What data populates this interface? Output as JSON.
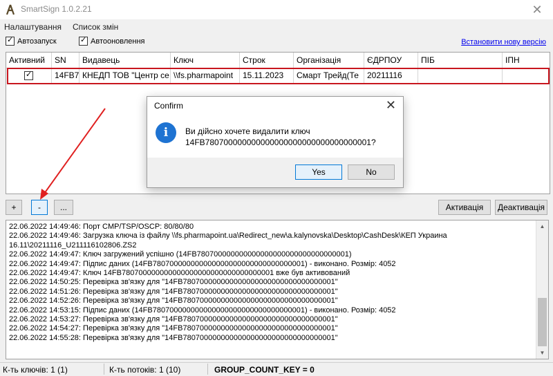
{
  "window": {
    "title": "SmartSign 1.0.2.21",
    "close_glyph": "✕"
  },
  "menu": {
    "items": [
      "Налаштування",
      "Список змін"
    ]
  },
  "options": {
    "autostart": {
      "label": "Автозапуск",
      "checked": true
    },
    "autoupdate": {
      "label": "Автооновлення",
      "checked": true
    },
    "new_version_link": "Встановити нову версію"
  },
  "table": {
    "headers": [
      "Активний",
      "SN",
      "Видавець",
      "Ключ",
      "Строк",
      "Організація",
      "ЄДРПОУ",
      "ПІБ",
      "ІПН"
    ],
    "rows": [
      {
        "active": true,
        "sn": "14FB7",
        "issuer": "КНЕДП ТОВ \"Центр се",
        "key": "\\\\fs.pharmapoint",
        "term": "15.11.2023",
        "organization": "Смарт Трейд(Те",
        "edrpou": "20211116",
        "pib": "",
        "ipn": ""
      }
    ]
  },
  "buttons": {
    "add": "+",
    "remove": "-",
    "more": "...",
    "activate": "Активація",
    "deactivate": "Деактивація"
  },
  "log": [
    "22.06.2022 14:49:46:   Порт CMP/TSP/OSCP: 80/80/80",
    "22.06.2022 14:49:46: Загрузка ключа із файлу \\\\fs.pharmapoint.ua\\Redirect_new\\a.kalynovska\\Desktop\\CashDesk\\КЕП Украина",
    "16.11\\20211116_U211116102806.ZS2",
    "22.06.2022 14:49:47: Ключ загружений успішно (14FB780700000000000000000000000000000001)",
    "22.06.2022 14:49:47: Підпис даних (14FB780700000000000000000000000000000001) - виконано. Розмір: 4052",
    "22.06.2022 14:49:47: Ключ 14FB780700000000000000000000000000000001 вже був активований",
    "22.06.2022 14:50:25: Перевірка зв'язку для \"14FB780700000000000000000000000000000001\"",
    "22.06.2022 14:51:26: Перевірка зв'язку для \"14FB780700000000000000000000000000000001\"",
    "22.06.2022 14:52:26: Перевірка зв'язку для \"14FB780700000000000000000000000000000001\"",
    "22.06.2022 14:53:15: Підпис даних (14FB780700000000000000000000000000000001) - виконано. Розмір: 4052",
    "22.06.2022 14:53:27: Перевірка зв'язку для \"14FB780700000000000000000000000000000001\"",
    "22.06.2022 14:54:27: Перевірка зв'язку для \"14FB780700000000000000000000000000000001\"",
    "22.06.2022 14:55:28: Перевірка зв'язку для \"14FB780700000000000000000000000000000001\""
  ],
  "status": {
    "keys": "К-ть ключів: 1 (1)",
    "threads": "К-ть потоків: 1 (10)",
    "group": "GROUP_COUNT_KEY = 0"
  },
  "dialog": {
    "title": "Confirm",
    "line1": "Ви дійсно хочете видалити ключ",
    "line2": "14FB780700000000000000000000000000000001?",
    "yes": "Yes",
    "no": "No",
    "icon": "info-icon"
  },
  "colors": {
    "highlight": "#c8161e",
    "arrow": "#e02020",
    "link": "#0000ee",
    "info_icon": "#1e73d2"
  }
}
